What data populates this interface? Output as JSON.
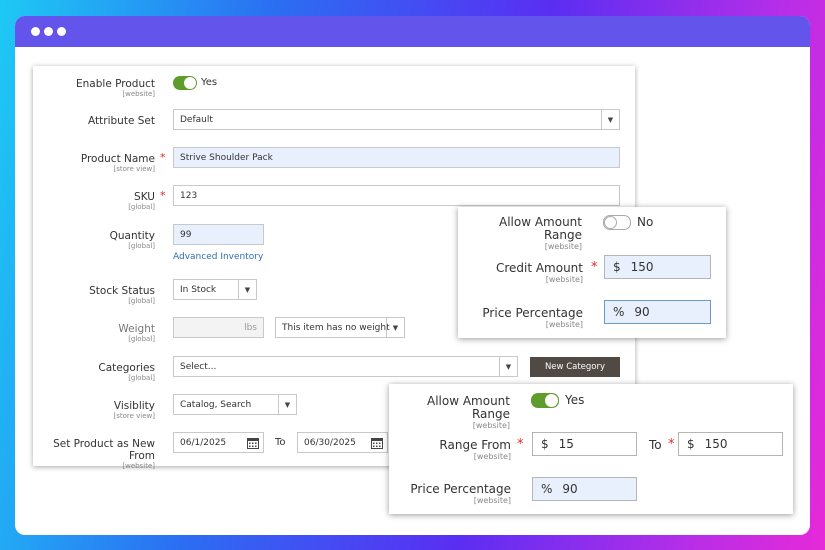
{
  "main": {
    "enable_product": {
      "label": "Enable Product",
      "scope": "[website]",
      "value": "Yes"
    },
    "attribute_set": {
      "label": "Attribute Set",
      "value": "Default"
    },
    "product_name": {
      "label": "Product Name",
      "scope": "[store view]",
      "value": "Strive Shoulder Pack"
    },
    "sku": {
      "label": "SKU",
      "scope": "[global]",
      "value": "123"
    },
    "quantity": {
      "label": "Quantity",
      "scope": "[global]",
      "value": "99",
      "link": "Advanced Inventory"
    },
    "stock_status": {
      "label": "Stock Status",
      "scope": "[global]",
      "value": "In Stock"
    },
    "weight": {
      "label": "Weight",
      "scope": "[global]",
      "unit": "lbs",
      "option": "This item has no weight"
    },
    "categories": {
      "label": "Categories",
      "scope": "[global]",
      "placeholder": "Select...",
      "button": "New Category"
    },
    "visibility": {
      "label": "Visiblity",
      "scope": "[store view]",
      "value": "Catalog, Search"
    },
    "new_from": {
      "label": "Set Product as New From",
      "scope": "[website]",
      "from": "06/1/2025",
      "to_label": "To",
      "to": "06/30/2025"
    }
  },
  "card_off": {
    "allow_amount_range": {
      "label": "Allow Amount Range",
      "scope": "[website]",
      "value": "No"
    },
    "credit_amount": {
      "label": "Credit Amount",
      "scope": "[website]",
      "prefix": "$",
      "value": "150"
    },
    "price_percentage": {
      "label": "Price Percentage",
      "scope": "[website]",
      "prefix": "%",
      "value": "90"
    }
  },
  "card_on": {
    "allow_amount_range": {
      "label": "Allow Amount Range",
      "scope": "[website]",
      "value": "Yes"
    },
    "range_from": {
      "label": "Range From",
      "scope": "[website]",
      "prefix": "$",
      "value": "15",
      "to_label": "To",
      "to_prefix": "$",
      "to_value": "150"
    },
    "price_percentage": {
      "label": "Price Percentage",
      "scope": "[website]",
      "prefix": "%",
      "value": "90"
    }
  },
  "colors": {
    "accent": "#6354ec",
    "toggle_on": "#5e9d2b",
    "required": "#e22626",
    "button": "#514943"
  }
}
